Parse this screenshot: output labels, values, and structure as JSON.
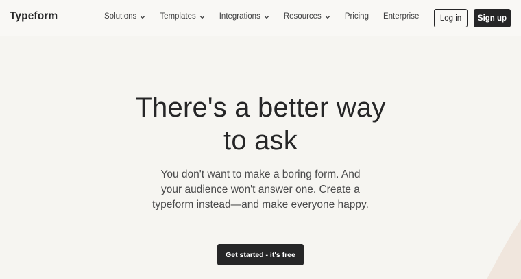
{
  "header": {
    "logo": "Typeform",
    "nav": [
      {
        "label": "Solutions",
        "dropdown": true,
        "icon": "chevron-down-icon"
      },
      {
        "label": "Templates",
        "dropdown": true,
        "icon": "chevron-down-icon"
      },
      {
        "label": "Integrations",
        "dropdown": true,
        "icon": "chevron-down-icon"
      },
      {
        "label": "Resources",
        "dropdown": true,
        "icon": "chevron-down-icon"
      },
      {
        "label": "Pricing",
        "dropdown": false
      },
      {
        "label": "Enterprise",
        "dropdown": false
      }
    ],
    "login_label": "Log in",
    "signup_label": "Sign up"
  },
  "hero": {
    "title_line1": "There's a better way",
    "title_line2": "to ask",
    "subtitle": "You don't want to make a boring form. And your audience won't answer one. Create a typeform instead—and make everyone happy.",
    "cta_label": "Get started - it's free"
  },
  "colors": {
    "background": "#f6f5f1",
    "header_background": "#f9f8f5",
    "text": "#262627",
    "button_dark": "#262627",
    "decoration": "#f0e6dd"
  }
}
